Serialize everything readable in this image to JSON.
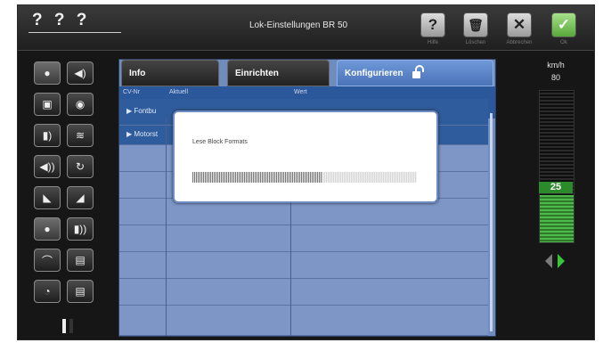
{
  "header": {
    "loco_id": "? ? ?",
    "title": "Lok-Einstellungen BR 50",
    "buttons": [
      {
        "icon": "?",
        "label": "Hilfe"
      },
      {
        "icon": "🗑",
        "label": "Löschen"
      },
      {
        "icon": "✕",
        "label": "Abbrechen"
      },
      {
        "icon": "✓",
        "label": "Ok"
      }
    ]
  },
  "tabs": [
    {
      "label": "Info"
    },
    {
      "label": "Einrichten"
    },
    {
      "label": "Konfigurieren"
    }
  ],
  "table": {
    "columns": [
      "CV-Nr",
      "Aktuell",
      "Wert"
    ],
    "rows": [
      {
        "label": "▶  Fontbu"
      },
      {
        "label": "▶  Motorst"
      }
    ]
  },
  "dialog": {
    "title": "Lese Block Formats",
    "progress": 0.58
  },
  "speed": {
    "unit": "km/h",
    "max": "80",
    "value": "25",
    "level": 0.31
  },
  "colors": {
    "accent": "#4a74b8",
    "speed_green": "#4fb84a"
  }
}
